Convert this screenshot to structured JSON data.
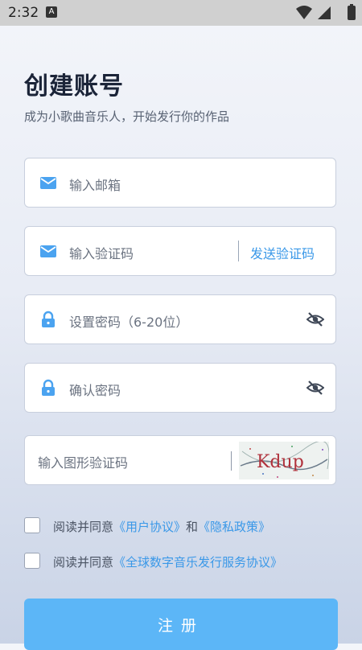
{
  "status_bar": {
    "time": "2:32",
    "notification_icon": "A"
  },
  "header": {
    "title": "创建账号",
    "subtitle": "成为小歌曲音乐人，开始发行你的作品"
  },
  "form": {
    "email_placeholder": "输入邮箱",
    "code_placeholder": "输入验证码",
    "send_code_label": "发送验证码",
    "password_placeholder": "设置密码（6-20位）",
    "confirm_password_placeholder": "确认密码",
    "captcha_placeholder": "输入图形验证码",
    "captcha_text": "Kdup"
  },
  "agreements": [
    {
      "prefix": "阅读并同意",
      "link1": "《用户协议》",
      "join": "和",
      "link2": "《隐私政策》"
    },
    {
      "prefix": "阅读并同意",
      "link1": "《全球数字音乐发行服务协议》"
    }
  ],
  "submit_label": "注册",
  "colors": {
    "accent": "#3a98e8",
    "button": "#5cb6f7",
    "icon": "#4ba3f0"
  },
  "icons": [
    "mail-icon",
    "lock-icon",
    "eye-off-icon",
    "wifi-icon",
    "cell-signal-icon",
    "battery-icon"
  ]
}
